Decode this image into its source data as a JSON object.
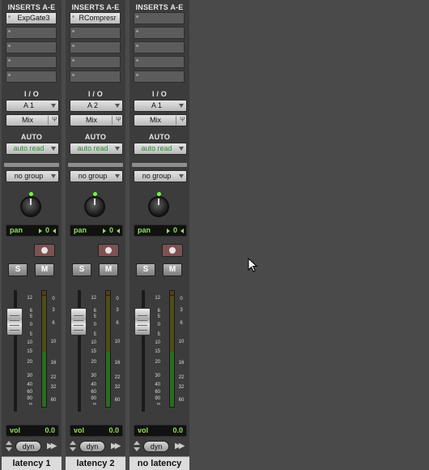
{
  "strip_labels": {
    "inserts": "INSERTS A-E",
    "io": "I / O",
    "auto": "AUTO"
  },
  "fader_scale": [
    "12",
    "6",
    "5",
    "0",
    "5",
    "10",
    "15",
    "20",
    "30",
    "40",
    "60",
    "90",
    "∞"
  ],
  "meter_scale": [
    "0",
    "3",
    "6",
    "10",
    "16",
    "22",
    "32",
    "60"
  ],
  "strips": [
    {
      "name": "latency 1",
      "inserts": [
        "ExpGate3",
        "",
        "",
        "",
        ""
      ],
      "output": "A 1",
      "input": "Mix",
      "automation": "auto read",
      "group": "no group",
      "pan_label": "pan",
      "pan_value": "0",
      "solo": "S",
      "mute": "M",
      "vol_label": "vol",
      "vol_value": "0.0",
      "dyn": "dyn"
    },
    {
      "name": "latency 2",
      "inserts": [
        "RCompresr",
        "",
        "",
        "",
        ""
      ],
      "output": "A 2",
      "input": "Mix",
      "automation": "auto read",
      "group": "no group",
      "pan_label": "pan",
      "pan_value": "0",
      "solo": "S",
      "mute": "M",
      "vol_label": "vol",
      "vol_value": "0.0",
      "dyn": "dyn"
    },
    {
      "name": "no latency",
      "inserts": [
        "",
        "",
        "",
        "",
        ""
      ],
      "output": "A 1",
      "input": "Mix",
      "automation": "auto read",
      "group": "no group",
      "pan_label": "pan",
      "pan_value": "0",
      "solo": "S",
      "mute": "M",
      "vol_label": "vol",
      "vol_value": "0.0",
      "dyn": "dyn"
    }
  ],
  "colors": {
    "display_green": "#8ee05a",
    "auto_text": "#2f8f2f",
    "record": "#7d5252"
  },
  "icons": [
    "record-icon",
    "fork-icon",
    "knob-icon",
    "fast-forward-icon",
    "updown-arrows-icon",
    "mouse-cursor-icon"
  ]
}
